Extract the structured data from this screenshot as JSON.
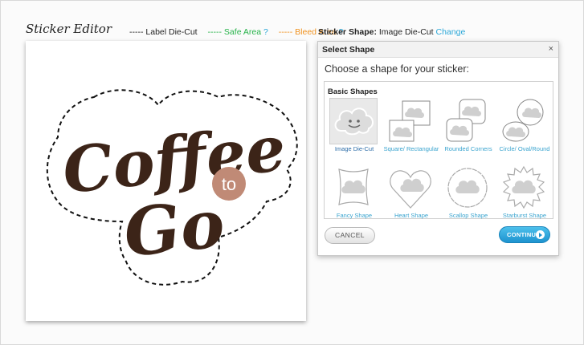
{
  "header": {
    "title": "Sticker Editor",
    "legend": {
      "label_die_cut": "----- Label Die-Cut",
      "safe_area": "----- Safe Area",
      "safe_help": "?",
      "bleed_area": "----- Bleed Area",
      "bleed_help": "?"
    },
    "sticker_shape_label": "Sticker Shape:",
    "sticker_shape_value": "Image Die-Cut",
    "change_link": "Change"
  },
  "canvas": {
    "word_top": "Coffee",
    "word_badge": "to",
    "word_bottom": "Go",
    "colors": {
      "text": "#3c2418",
      "badge": "#c08a76",
      "cutline": "#111111"
    }
  },
  "dialog": {
    "title": "Select Shape",
    "close": "×",
    "prompt": "Choose a shape for your sticker:",
    "section": "Basic Shapes",
    "shapes": [
      {
        "label": "Image Die-Cut",
        "icon": "cloud-die-cut-icon"
      },
      {
        "label": "Square/ Rectangular",
        "icon": "square-shape-icon"
      },
      {
        "label": "Rounded Corners",
        "icon": "rounded-corners-icon"
      },
      {
        "label": "Circle/ Oval/Round",
        "icon": "circle-shape-icon"
      },
      {
        "label": "Fancy Shape",
        "icon": "fancy-shape-icon"
      },
      {
        "label": "Heart Shape",
        "icon": "heart-shape-icon"
      },
      {
        "label": "Scallop Shape",
        "icon": "scallop-shape-icon"
      },
      {
        "label": "Starburst Shape",
        "icon": "starburst-shape-icon"
      }
    ],
    "cancel_label": "CANCEL",
    "continue_label": "CONTINUE"
  },
  "colors": {
    "accent": "#2aa7d8",
    "safe": "#27b34a",
    "bleed": "#f0921e"
  }
}
